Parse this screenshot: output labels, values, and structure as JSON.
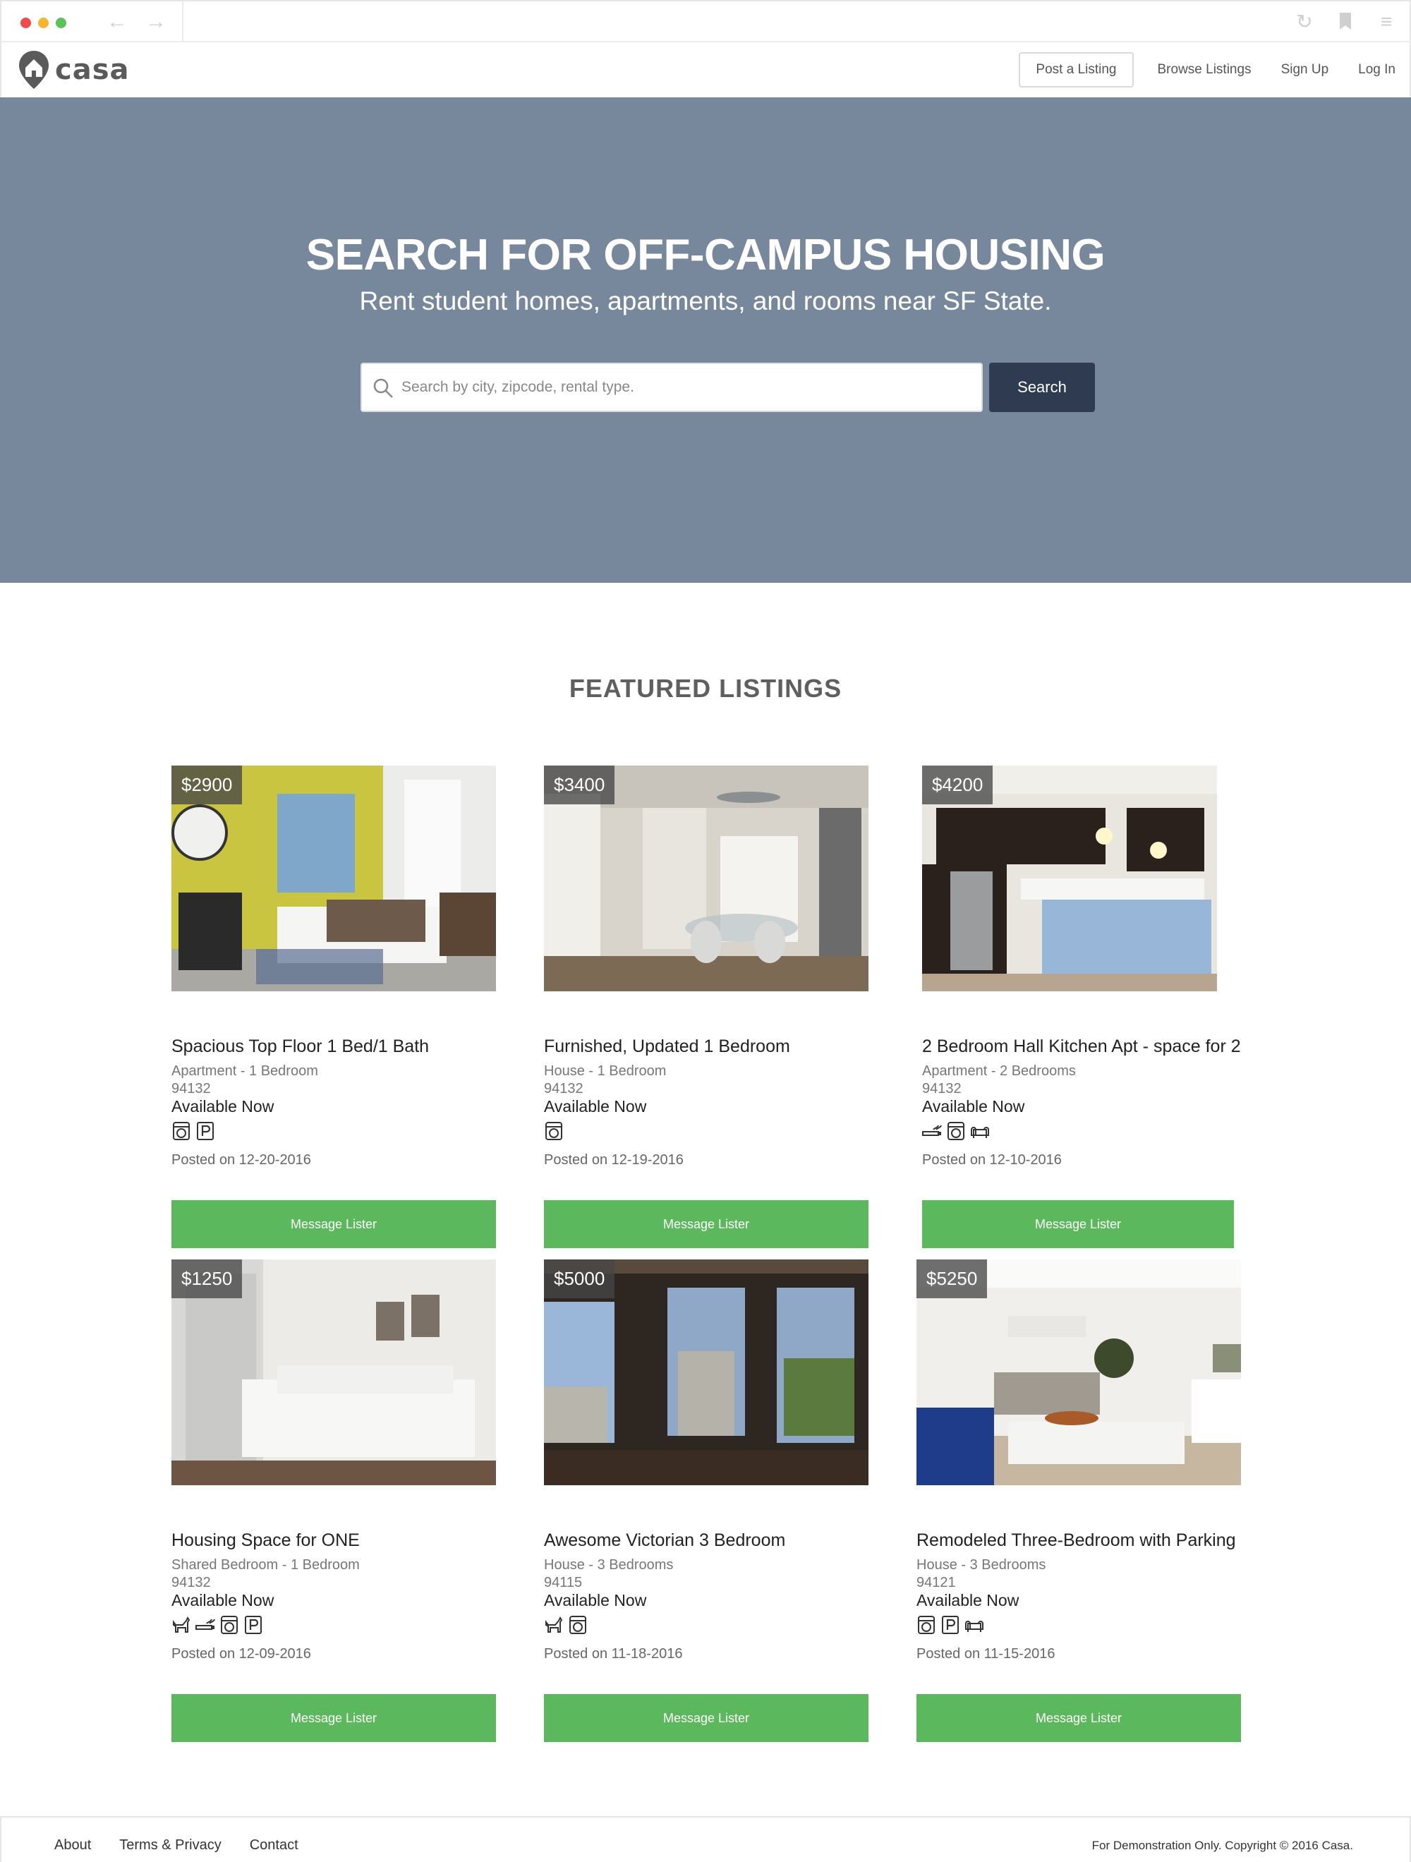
{
  "browser": {
    "icons": [
      "back-arrow-icon",
      "forward-arrow-icon",
      "reload-icon",
      "bookmark-icon",
      "menu-icon"
    ]
  },
  "header": {
    "logo_text": "casa",
    "nav": {
      "post_listing": "Post a Listing",
      "browse": "Browse Listings",
      "signup": "Sign Up",
      "login": "Log In"
    }
  },
  "hero": {
    "title": "SEARCH FOR OFF-CAMPUS HOUSING",
    "subtitle": "Rent student homes, apartments, and rooms near SF State.",
    "search_placeholder": "Search by city, zipcode, rental type.",
    "search_button": "Search",
    "background_color": "#78889c"
  },
  "featured": {
    "title": "FEATURED LISTINGS",
    "listings": [
      {
        "price": "$2900",
        "title": "Spacious Top Floor 1 Bed/1 Bath",
        "type": "Apartment - 1 Bedroom",
        "zip": "94132",
        "availability": "Available Now",
        "amenities": [
          "laundry-icon",
          "parking-icon"
        ],
        "posted": "Posted on 12-20-2016",
        "button": "Message Lister"
      },
      {
        "price": "$3400",
        "title": "Furnished, Updated 1 Bedroom",
        "type": "House - 1 Bedroom",
        "zip": "94132",
        "availability": "Available Now",
        "amenities": [
          "laundry-icon"
        ],
        "posted": "Posted on 12-19-2016",
        "button": "Message Lister"
      },
      {
        "price": "$4200",
        "title": "2 Bedroom Hall Kitchen Apt - space for 2",
        "type": "Apartment - 2 Bedrooms",
        "zip": "94132",
        "availability": "Available Now",
        "amenities": [
          "no-smoking-icon",
          "laundry-icon",
          "furnished-icon"
        ],
        "posted": "Posted on 12-10-2016",
        "button": "Message Lister"
      },
      {
        "price": "$1250",
        "title": "Housing Space for ONE",
        "type": "Shared Bedroom - 1 Bedroom",
        "zip": "94132",
        "availability": "Available Now",
        "amenities": [
          "pets-icon",
          "no-smoking-icon",
          "laundry-icon",
          "parking-icon"
        ],
        "posted": "Posted on 12-09-2016",
        "button": "Message Lister"
      },
      {
        "price": "$5000",
        "title": "Awesome Victorian 3 Bedroom",
        "type": "House - 3 Bedrooms",
        "zip": "94115",
        "availability": "Available Now",
        "amenities": [
          "pets-icon",
          "laundry-icon"
        ],
        "posted": "Posted on 11-18-2016",
        "button": "Message Lister"
      },
      {
        "price": "$5250",
        "title": "Remodeled Three-Bedroom with Parking",
        "type": "House - 3 Bedrooms",
        "zip": "94121",
        "availability": "Available Now",
        "amenities": [
          "laundry-icon",
          "parking-icon",
          "furnished-icon"
        ],
        "posted": "Posted on 11-15-2016",
        "button": "Message Lister"
      }
    ]
  },
  "footer": {
    "links": [
      "About",
      "Terms & Privacy",
      "Contact"
    ],
    "copyright": "For Demonstration Only. Copyright © 2016 Casa."
  },
  "colors": {
    "accent_green": "#5cb85c",
    "search_button": "#2e3b50"
  }
}
